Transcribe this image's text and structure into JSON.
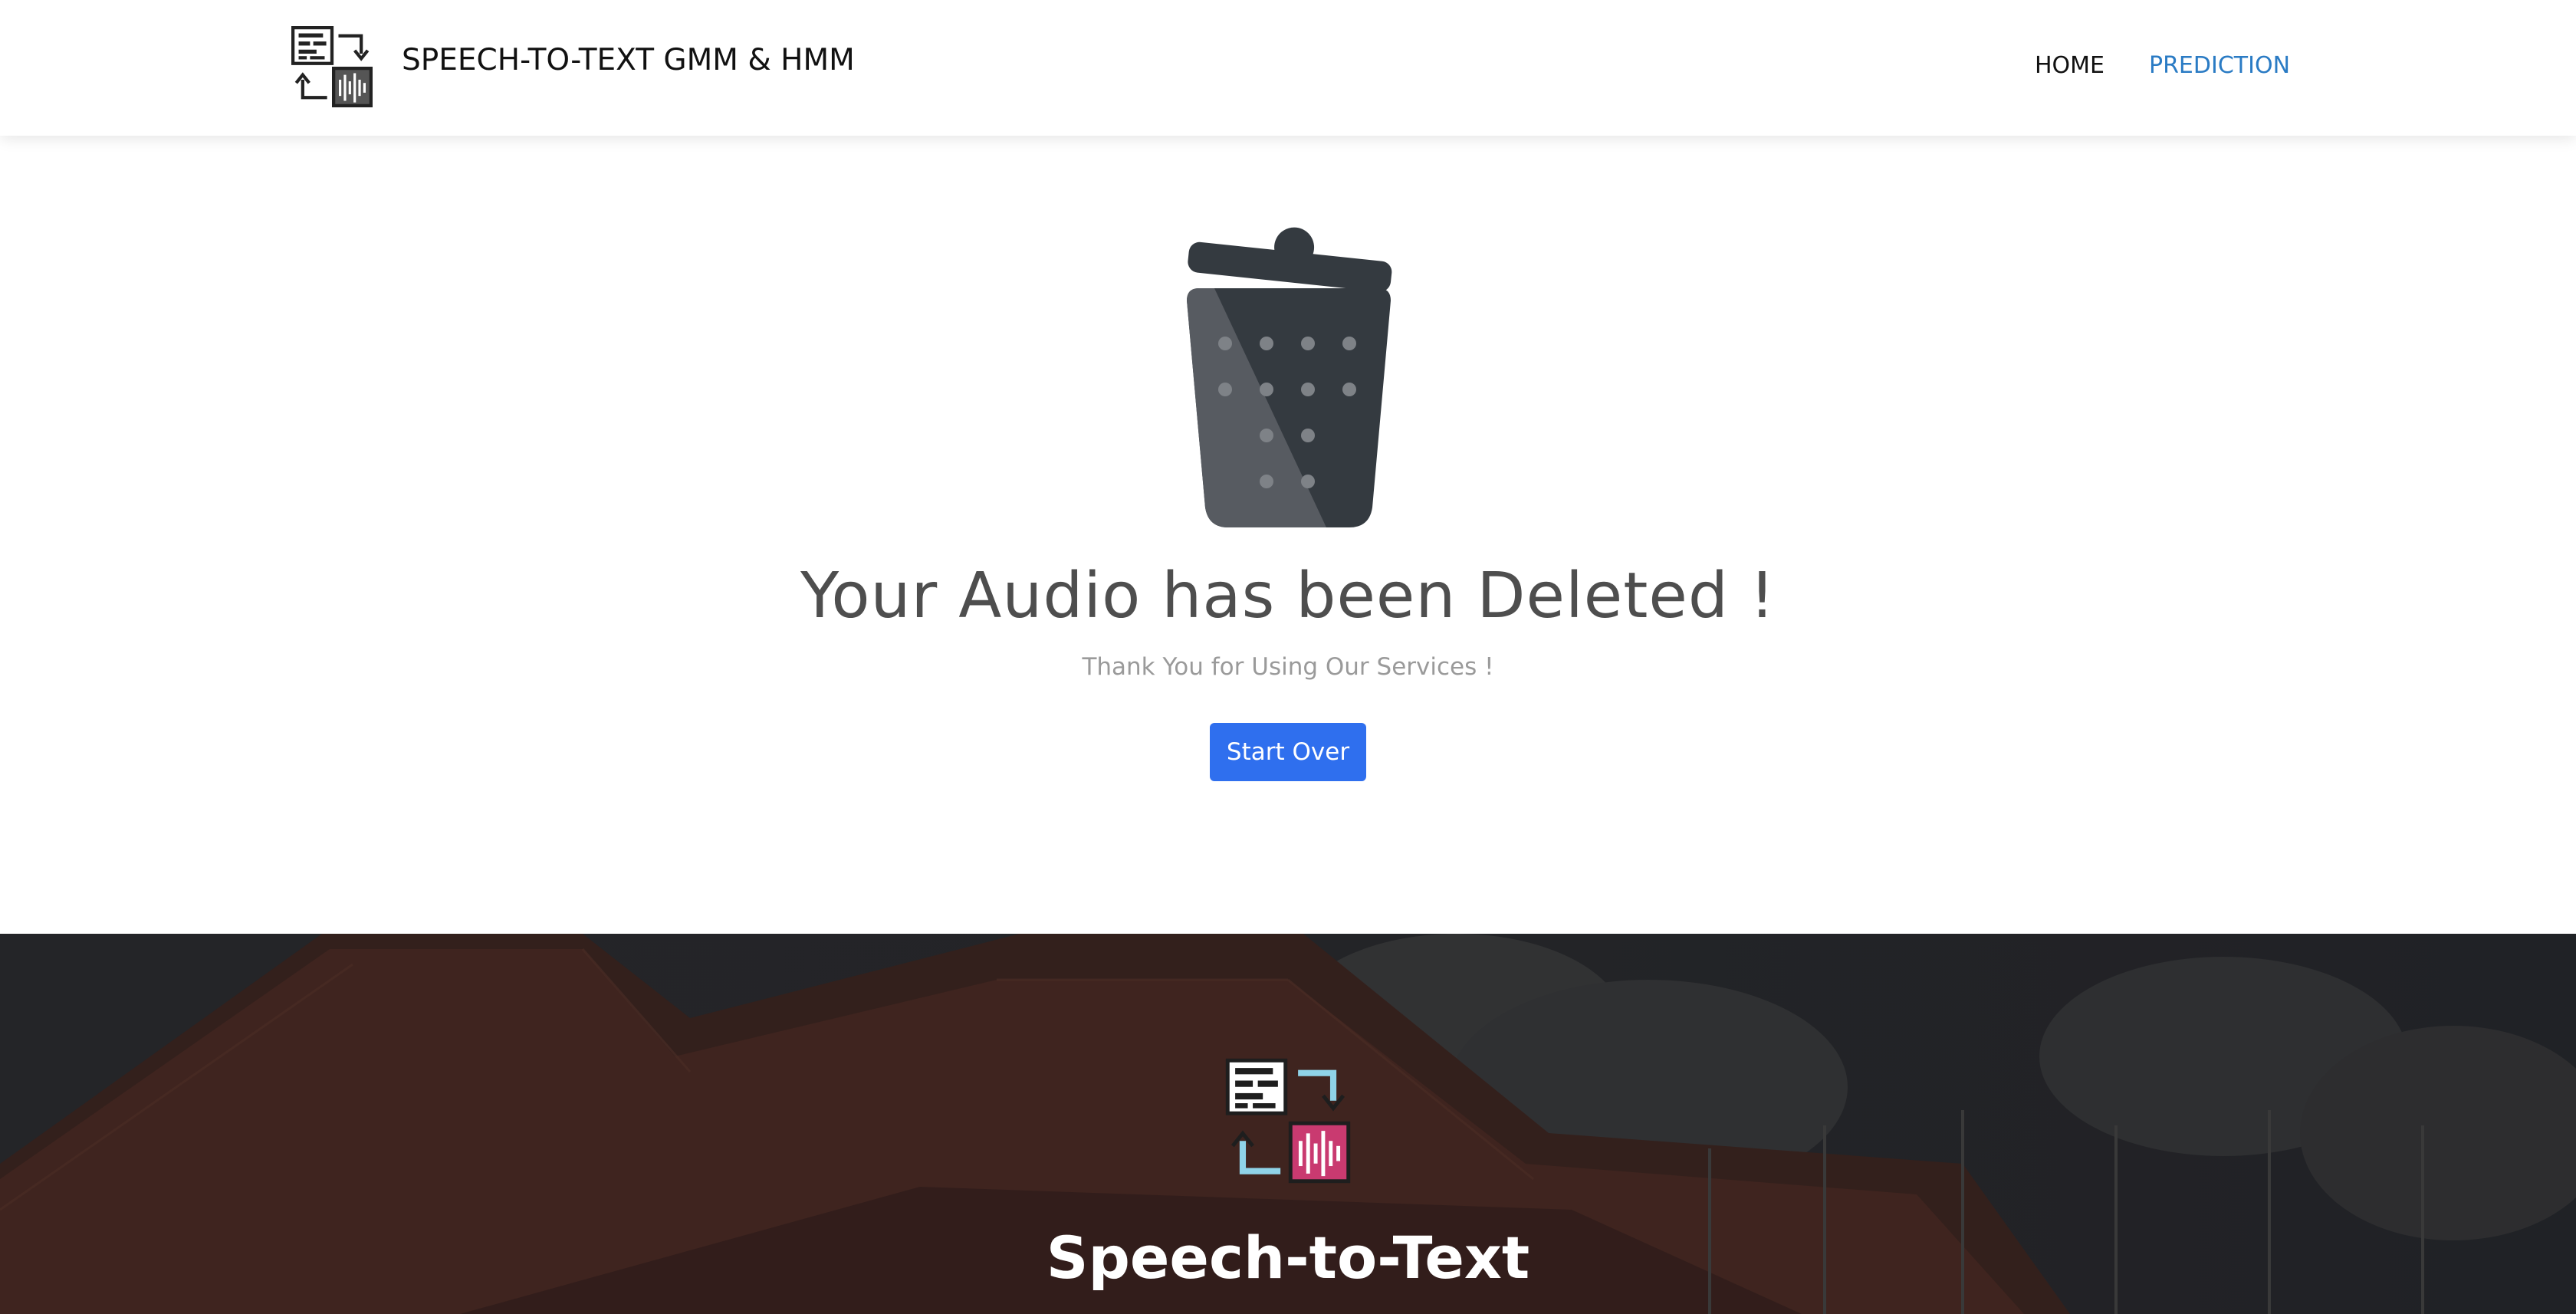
{
  "navbar": {
    "brand_text": "SPEECH-TO-TEXT GMM & HMM",
    "brand_icon": "speech-to-text-logo-icon",
    "links": [
      {
        "label": "HOME",
        "active": false
      },
      {
        "label": "PREDICTION",
        "active": true
      }
    ],
    "active_color": "#2a7bc4"
  },
  "main": {
    "icon": "trash-bin-icon",
    "title": "Your Audio has been Deleted !",
    "subtitle": "Thank You for Using Our Services !",
    "button_label": "Start Over",
    "button_color": "#2f6fee"
  },
  "banner": {
    "icon": "speech-to-text-logo-icon",
    "title": "Speech-to-Text"
  }
}
